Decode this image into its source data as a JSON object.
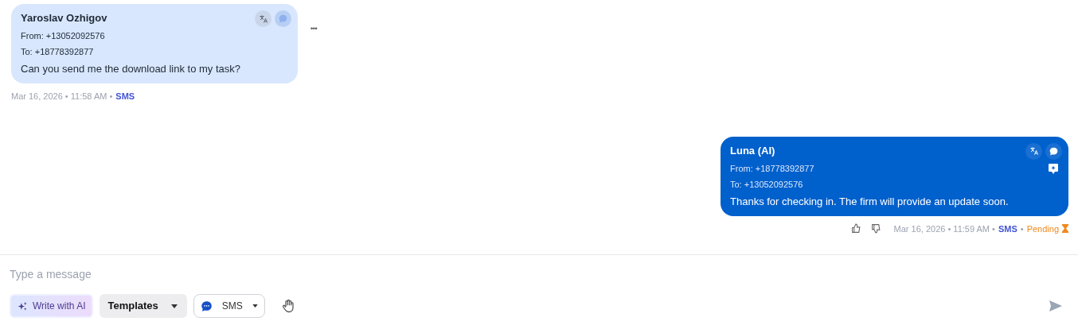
{
  "messages": [
    {
      "kind": "incoming",
      "sender": "Yaroslav Ozhigov",
      "from": "From: +13052092576",
      "to": "To: +18778392877",
      "text": "Can you send me the download link to my task?",
      "time": "Mar 16, 2026 • 11:58 AM •",
      "channel": "SMS",
      "more": "•••"
    },
    {
      "kind": "outgoing",
      "sender": "Luna (AI)",
      "from": "From: +18778392877",
      "to": "To: +13052092576",
      "text": "Thanks for checking in. The firm will provide an update soon.",
      "time": "Mar 16, 2026 • 11:59 AM •",
      "channel": "SMS",
      "status": "Pending",
      "status_sep": "•"
    }
  ],
  "composer": {
    "placeholder": "Type a message",
    "write_ai": "Write with AI",
    "templates": "Templates",
    "channel": "SMS"
  }
}
